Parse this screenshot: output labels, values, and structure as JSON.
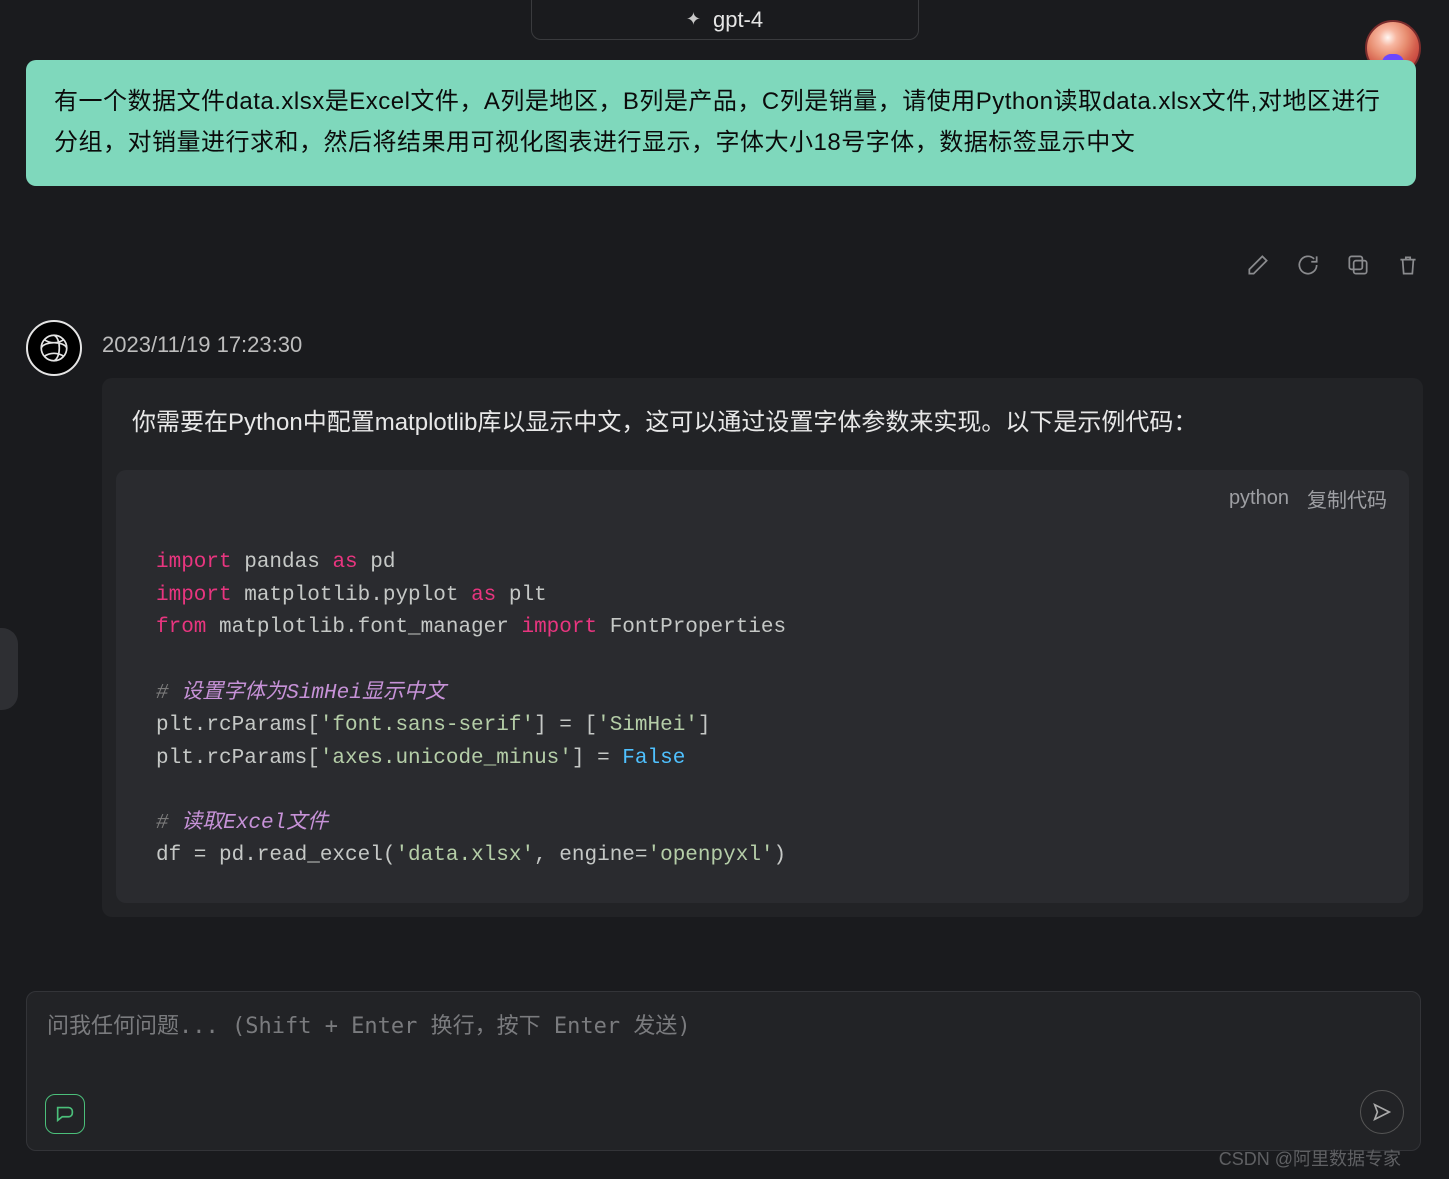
{
  "header": {
    "model_label": "gpt-4"
  },
  "user_message": {
    "text": "有一个数据文件data.xlsx是Excel文件，A列是地区，B列是产品，C列是销量，请使用Python读取data.xlsx文件,对地区进行分组，对销量进行求和，然后将结果用可视化图表进行显示，字体大小18号字体，数据标签显示中文"
  },
  "actions": {
    "edit": "edit",
    "regen": "regenerate",
    "copy": "copy",
    "delete": "delete"
  },
  "assistant": {
    "timestamp": "2023/11/19 17:23:30",
    "text": "你需要在Python中配置matplotlib库以显示中文，这可以通过设置字体参数来实现。以下是示例代码：",
    "code": {
      "language": "python",
      "copy_label": "复制代码",
      "lines": [
        {
          "tokens": [
            {
              "t": "import ",
              "c": "kw"
            },
            {
              "t": "pandas ",
              "c": "mod"
            },
            {
              "t": "as ",
              "c": "kw"
            },
            {
              "t": "pd",
              "c": "mod"
            }
          ]
        },
        {
          "tokens": [
            {
              "t": "import ",
              "c": "kw"
            },
            {
              "t": "matplotlib.pyplot ",
              "c": "mod"
            },
            {
              "t": "as ",
              "c": "kw"
            },
            {
              "t": "plt",
              "c": "mod"
            }
          ]
        },
        {
          "tokens": [
            {
              "t": "from ",
              "c": "kw"
            },
            {
              "t": "matplotlib.font_manager ",
              "c": "mod"
            },
            {
              "t": "import ",
              "c": "kw"
            },
            {
              "t": "FontProperties",
              "c": "mod"
            }
          ]
        },
        {
          "tokens": []
        },
        {
          "tokens": [
            {
              "t": "# ",
              "c": "com"
            },
            {
              "t": "设置字体为SimHei显示中文",
              "c": "comhi"
            }
          ]
        },
        {
          "tokens": [
            {
              "t": "plt.rcParams[",
              "c": "mod"
            },
            {
              "t": "'font.sans-serif'",
              "c": "str"
            },
            {
              "t": "] = [",
              "c": "mod"
            },
            {
              "t": "'SimHei'",
              "c": "str"
            },
            {
              "t": "]",
              "c": "mod"
            }
          ]
        },
        {
          "tokens": [
            {
              "t": "plt.rcParams[",
              "c": "mod"
            },
            {
              "t": "'axes.unicode_minus'",
              "c": "str"
            },
            {
              "t": "] = ",
              "c": "mod"
            },
            {
              "t": "False",
              "c": "bool"
            }
          ]
        },
        {
          "tokens": []
        },
        {
          "tokens": [
            {
              "t": "# ",
              "c": "com"
            },
            {
              "t": "读取Excel文件",
              "c": "comhi"
            }
          ]
        },
        {
          "tokens": [
            {
              "t": "df = pd.read_excel(",
              "c": "mod"
            },
            {
              "t": "'data.xlsx'",
              "c": "str"
            },
            {
              "t": ", engine=",
              "c": "mod"
            },
            {
              "t": "'openpyxl'",
              "c": "str"
            },
            {
              "t": ")",
              "c": "mod"
            }
          ]
        }
      ]
    }
  },
  "input": {
    "placeholder": "问我任何问题... (Shift + Enter 换行，按下 Enter 发送)"
  },
  "watermark": "CSDN @阿里数据专家"
}
